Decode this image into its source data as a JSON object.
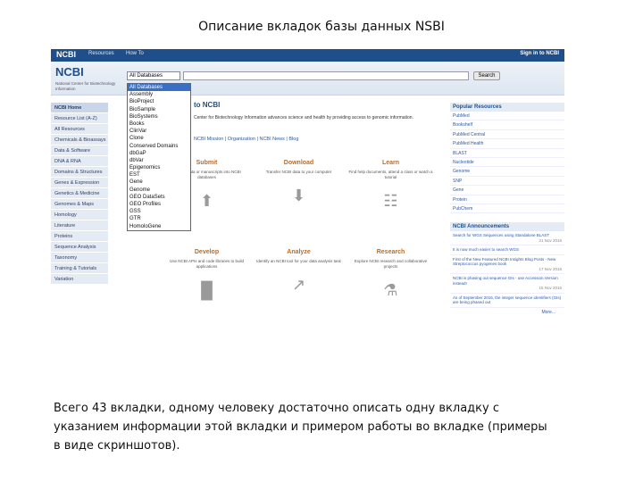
{
  "slide": {
    "title": "Описание вкладок базы данных NSBI",
    "caption": "Всего 43 вкладки, одному человеку достаточно описать одну вкладку с указанием информации этой вкладки и примером работы во вкладке (примеры в виде скриншотов)."
  },
  "ncbi": {
    "topbar": {
      "logo": "NCBI",
      "resources": "Resources",
      "howto": "How To",
      "signin": "Sign in to NCBI"
    },
    "brand": "NCBI",
    "brand_sub": "National Center for Biotechnology Information",
    "db_select": "All Databases",
    "search_button": "Search",
    "sidebar": [
      "NCBI Home",
      "Resource List (A-Z)",
      "All Resources",
      "Chemicals & Bioassays",
      "Data & Software",
      "DNA & RNA",
      "Domains & Structures",
      "Genes & Expression",
      "Genetics & Medicine",
      "Genomes & Maps",
      "Homology",
      "Literature",
      "Proteins",
      "Sequence Analysis",
      "Taxonomy",
      "Training & Tutorials",
      "Variation"
    ],
    "dropdown": [
      "All Databases",
      "Assembly",
      "BioProject",
      "BioSample",
      "BioSystems",
      "Books",
      "ClinVar",
      "Clone",
      "Conserved Domains",
      "dbGaP",
      "dbVar",
      "Epigenomics",
      "EST",
      "Gene",
      "Genome",
      "GEO DataSets",
      "GEO Profiles",
      "GSS",
      "GTR",
      "HomoloGene"
    ],
    "welcome": "to NCBI",
    "intro": "Center for Biotechnology Information advances science and health by providing access to genomic information.",
    "intro_links": "NCBI Mission | Organization | NCBI News | Blog",
    "tasks": {
      "submit": {
        "title": "Submit",
        "desc": "Deposit data or manuscripts into NCBI databases"
      },
      "download": {
        "title": "Download",
        "desc": "Transfer NCBI data to your computer"
      },
      "learn": {
        "title": "Learn",
        "desc": "Find help documents, attend a class or watch a tutorial"
      },
      "develop": {
        "title": "Develop",
        "desc": "Use NCBI APIs and code libraries to build applications"
      },
      "analyze": {
        "title": "Analyze",
        "desc": "Identify an NCBI tool for your data analysis task"
      },
      "research": {
        "title": "Research",
        "desc": "Explore NCBI research and collaborative projects"
      }
    },
    "popular_title": "Popular Resources",
    "popular": [
      "PubMed",
      "Bookshelf",
      "PubMed Central",
      "PubMed Health",
      "BLAST",
      "Nucleotide",
      "Genome",
      "SNP",
      "Gene",
      "Protein",
      "PubChem"
    ],
    "announce_title": "NCBI Announcements",
    "announcements": [
      {
        "text": "Search for WGS Sequences using Standalone BLAST",
        "date": "21 Nov 2016"
      },
      {
        "text": "It is now much easier to search WGS",
        "date": ""
      },
      {
        "text": "First of the New Featured NCBI Insights Blog Posts - New Streptococcus pyogenes book",
        "date": "17 Nov 2016"
      },
      {
        "text": "NCBI is phasing out sequence GIs - use Accession.Version instead!",
        "date": "15 Nov 2016"
      },
      {
        "text": "As of September 2016, the integer sequence identifiers (GIs) are being phased out",
        "date": ""
      }
    ],
    "more": "More..."
  }
}
